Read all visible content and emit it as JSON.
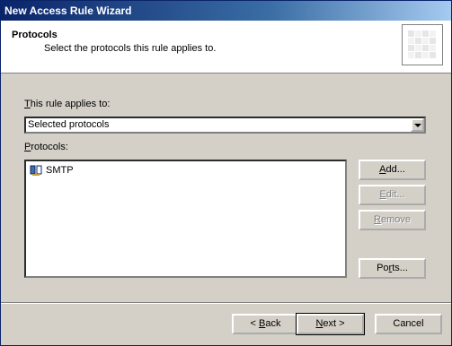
{
  "window": {
    "title": "New Access Rule Wizard"
  },
  "header": {
    "title": "Protocols",
    "subtitle": "Select the protocols this rule applies to."
  },
  "applies_to": {
    "label_access_key": "T",
    "label_rest": "his rule applies to:",
    "selected": "Selected protocols"
  },
  "protocols": {
    "label_access_key": "P",
    "label_rest": "rotocols:",
    "items": [
      {
        "name": "SMTP",
        "icon": "protocol-icon"
      }
    ]
  },
  "buttons": {
    "add": {
      "key": "A",
      "rest": "dd..."
    },
    "edit": {
      "key": "E",
      "rest": "dit..."
    },
    "remove": {
      "key": "R",
      "rest": "emove"
    },
    "ports_pre": "Po",
    "ports_key": "r",
    "ports_rest": "ts...",
    "back_pre": "< ",
    "back_key": "B",
    "back_rest": "ack",
    "next_key": "N",
    "next_rest": "ext >",
    "cancel": "Cancel"
  },
  "colors": {
    "title_bar": "#0a246a",
    "dialog_face": "#d4d0c8"
  }
}
